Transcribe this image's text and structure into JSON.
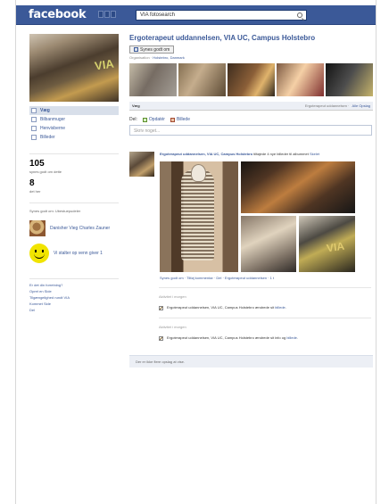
{
  "header": {
    "logo": "facebook",
    "search_value": "VIA fotosearch"
  },
  "left": {
    "nav": [
      {
        "label": "Væg"
      },
      {
        "label": "Bilbanmuger"
      },
      {
        "label": "Henvisberne"
      },
      {
        "label": "Billeder"
      }
    ],
    "stats": [
      {
        "value": "105",
        "label": "synes godt om dette"
      },
      {
        "value": "8",
        "label": "det her"
      }
    ],
    "friends_title": "Synes godt om: Ubestuepudeler",
    "friends": [
      {
        "name": "Danisher Vieg\nCharles Zauner"
      },
      {
        "name": "Vi stalter op venn\ngiver 1"
      }
    ],
    "links": [
      "Er det din forretning?",
      "Opret en Side",
      "Tilgængelighed rundt VIA",
      "Kommet Side",
      "Del"
    ]
  },
  "main": {
    "title": "Ergoterapeut uddannelsen, VIA UC, Campus Holstebro",
    "like_button": "Synes godt om",
    "meta": [
      "Organisation",
      "Holstebro, Danmark"
    ],
    "tabs": {
      "active": "Væg",
      "filter": "Ergoterapeut uddannelsen",
      "filter_link": "Alle Opslag"
    },
    "share": {
      "label": "Del:",
      "status": "Opdatér",
      "photo": "Billede"
    },
    "composer_placeholder": "Skriv noget...",
    "post": {
      "author": "Ergoterapeut uddannelsen, VIA UC, Campus Holstebro",
      "text": "tilføjede 4 nye billeder til albummet",
      "album": "Skelet",
      "actions": "Synes godt om · Tilføj kommentar · Del · af Ergoterapeut uddannelsen · for 3 timer siden",
      "footer": "Synes godt om · Tilføj kommentar · Del · Ergoterapeut uddannelsen · 1 t"
    },
    "activities": [
      {
        "time": "Aktivitet i morgen",
        "text": "Ergoterapeut uddannelsen, VIA UC, Campus Holstebro ændrede sit",
        "link": "billede"
      },
      {
        "time": "Aktivitet i morgen",
        "text": "Ergoterapeut uddannelsen, VIA UC, Campus Holstebro ændrede sit info og",
        "link": "billede"
      }
    ],
    "older_posts": "Der er ikke flere opslag at vise."
  }
}
